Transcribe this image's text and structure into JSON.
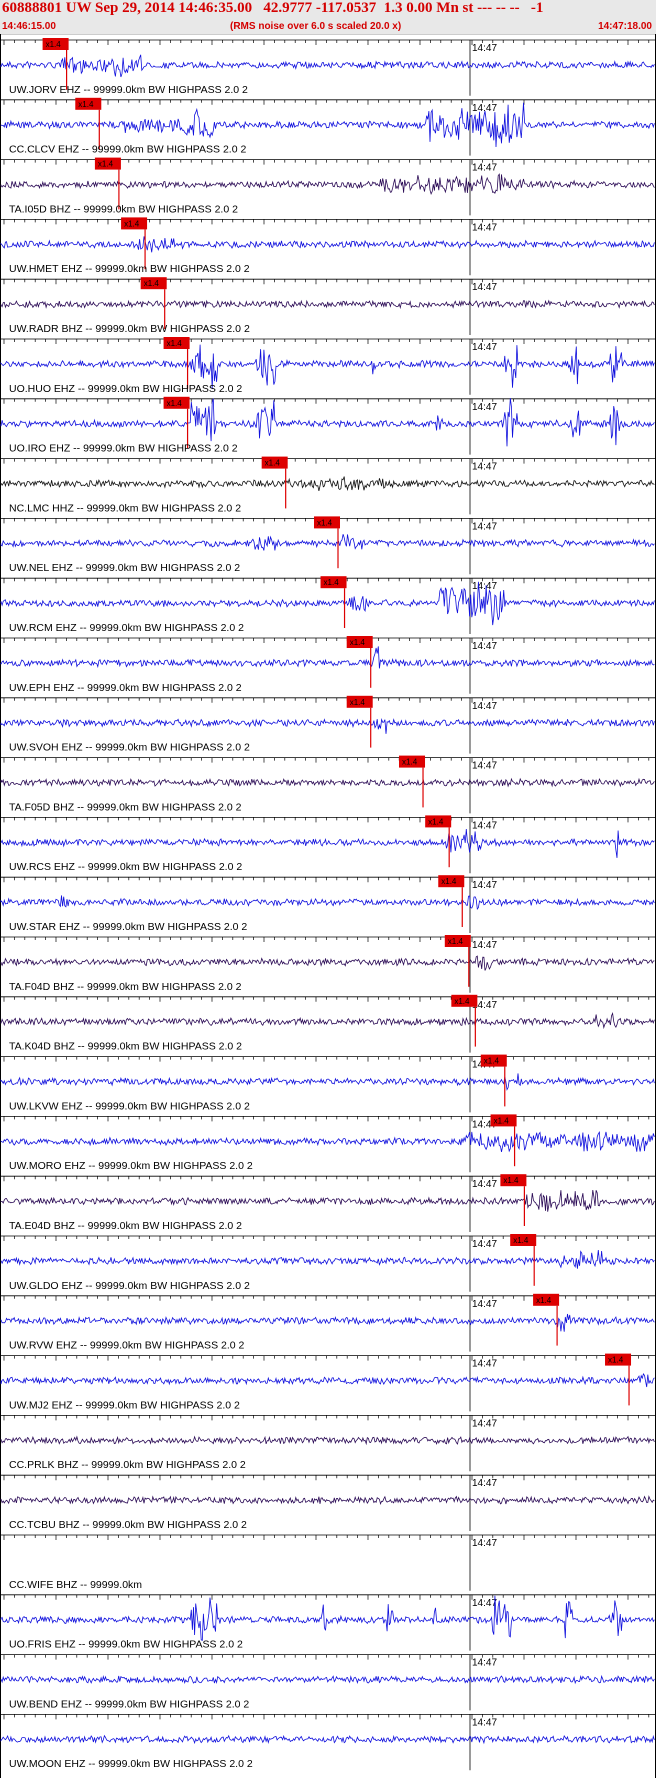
{
  "header": {
    "title": "60888801 UW Sep 29, 2014 14:46:35.00   42.9777 -117.0537  1.3 0.00 Mn st --- -- --   -1",
    "time_start": "14:46:15.00",
    "rms_note": "(RMS noise over 6.0 s scaled 20.0 x)",
    "time_end": "14:47:18.00"
  },
  "colors": {
    "blue": "#1010dd",
    "dark": "#2a0a55",
    "black": "#111111",
    "red": "#dd0000",
    "grid": "#000000"
  },
  "minute_label": "14:47",
  "pick_label": "x1.4",
  "traces": [
    {
      "label": "UW.JORV EHZ -- 99999.0km BW  HIGHPASS  2.0  2",
      "color": "blue",
      "pick": 0.085,
      "events": [
        [
          0.16,
          0.22,
          2.4
        ],
        [
          0.09,
          0.16,
          1.5
        ]
      ]
    },
    {
      "label": "CC.CLCV EHZ -- 99999.0km BW  HIGHPASS  2.0  2",
      "color": "blue",
      "pick": 0.135,
      "events": [
        [
          0.28,
          0.33,
          3.0
        ],
        [
          0.18,
          0.28,
          1.6
        ],
        [
          0.65,
          0.8,
          4.2
        ]
      ]
    },
    {
      "label": "TA.I05D BHZ -- 99999.0km BW  HIGHPASS  2.0  2",
      "color": "dark",
      "pick": 0.165,
      "events": [
        [
          0.58,
          0.8,
          2.0
        ]
      ]
    },
    {
      "label": "UW.HMET EHZ -- 99999.0km BW  HIGHPASS  2.0  2",
      "color": "blue",
      "pick": 0.205,
      "events": [
        [
          0.21,
          0.28,
          1.6
        ]
      ]
    },
    {
      "label": "UW.RADR BHZ -- 99999.0km BW  HIGHPASS  2.0  2",
      "color": "dark",
      "pick": 0.235,
      "events": []
    },
    {
      "label": "UO.HUO EHZ -- 99999.0km BW  HIGHPASS  2.0  2",
      "color": "blue",
      "pick": 0.27,
      "events": [
        [
          0.29,
          0.33,
          5.0
        ],
        [
          0.39,
          0.42,
          5.0
        ],
        [
          0.565,
          0.575,
          4.0
        ],
        [
          0.77,
          0.79,
          5.0
        ],
        [
          0.87,
          0.885,
          4.0
        ],
        [
          0.93,
          0.95,
          5.0
        ]
      ]
    },
    {
      "label": "UO.IRO EHZ -- 99999.0km BW  HIGHPASS  2.0  2",
      "color": "blue",
      "pick": 0.27,
      "events": [
        [
          0.29,
          0.33,
          5.0
        ],
        [
          0.39,
          0.42,
          5.0
        ],
        [
          0.665,
          0.675,
          3.5
        ],
        [
          0.77,
          0.79,
          5.0
        ],
        [
          0.87,
          0.885,
          4.0
        ],
        [
          0.93,
          0.95,
          5.0
        ]
      ]
    },
    {
      "label": "NC.LMC HHZ -- 99999.0km BW  HIGHPASS  2.0  2",
      "color": "black",
      "pick": 0.42,
      "events": [
        [
          0.44,
          0.6,
          1.5
        ]
      ]
    },
    {
      "label": "UW.NEL EHZ -- 99999.0km BW  HIGHPASS  2.0  2",
      "color": "blue",
      "pick": 0.5,
      "events": [
        [
          0.38,
          0.42,
          1.8
        ],
        [
          0.52,
          0.56,
          1.8
        ]
      ]
    },
    {
      "label": "UW.RCM EHZ -- 99999.0km BW  HIGHPASS  2.0  2",
      "color": "blue",
      "pick": 0.51,
      "events": [
        [
          0.53,
          0.56,
          2.0
        ],
        [
          0.67,
          0.77,
          4.5
        ]
      ]
    },
    {
      "label": "UW.EPH EHZ -- 99999.0km BW  HIGHPASS  2.0  2",
      "color": "blue",
      "pick": 0.55,
      "events": [
        [
          0.57,
          0.58,
          4.5
        ]
      ]
    },
    {
      "label": "UW.SVOH EHZ -- 99999.0km BW  HIGHPASS  2.0  2",
      "color": "blue",
      "pick": 0.55,
      "events": [
        [
          0.57,
          0.59,
          2.2
        ]
      ]
    },
    {
      "label": "TA.F05D BHZ -- 99999.0km BW  HIGHPASS  2.0  2",
      "color": "dark",
      "pick": 0.63,
      "events": []
    },
    {
      "label": "UW.RCS EHZ -- 99999.0km BW  HIGHPASS  2.0  2",
      "color": "blue",
      "pick": 0.67,
      "events": [
        [
          0.68,
          0.74,
          2.6
        ],
        [
          0.94,
          0.945,
          3.5
        ]
      ]
    },
    {
      "label": "UW.STAR EHZ -- 99999.0km BW  HIGHPASS  2.0  2",
      "color": "blue",
      "pick": 0.69,
      "events": [
        [
          0.09,
          0.11,
          2.0
        ],
        [
          0.71,
          0.73,
          2.2
        ]
      ]
    },
    {
      "label": "TA.F04D BHZ -- 99999.0km BW  HIGHPASS  2.0  2",
      "color": "dark",
      "pick": 0.7,
      "events": [
        [
          0.72,
          0.75,
          2.0
        ]
      ]
    },
    {
      "label": "TA.K04D BHZ -- 99999.0km BW  HIGHPASS  2.0  2",
      "color": "dark",
      "pick": 0.71,
      "events": [
        [
          0.9,
          0.95,
          1.8
        ]
      ]
    },
    {
      "label": "UW.LKVW EHZ -- 99999.0km BW  HIGHPASS  2.0  2",
      "color": "blue",
      "pick": 0.755,
      "events": [
        [
          0.77,
          0.8,
          1.6
        ]
      ]
    },
    {
      "label": "UW.MORO EHZ -- 99999.0km BW  HIGHPASS  2.0  2",
      "color": "blue",
      "pick": 0.77,
      "events": [
        [
          0.71,
          1.0,
          2.2
        ]
      ]
    },
    {
      "label": "TA.E04D BHZ -- 99999.0km BW  HIGHPASS  2.0  2",
      "color": "dark",
      "pick": 0.785,
      "events": [
        [
          0.8,
          0.92,
          2.4
        ]
      ]
    },
    {
      "label": "UW.GLDO EHZ -- 99999.0km BW  HIGHPASS  2.0  2",
      "color": "blue",
      "pick": 0.8,
      "events": [
        [
          0.85,
          0.92,
          2.0
        ]
      ]
    },
    {
      "label": "UW.RVW EHZ -- 99999.0km BW  HIGHPASS  2.0  2",
      "color": "blue",
      "pick": 0.835,
      "events": [
        [
          0.85,
          0.87,
          2.8
        ]
      ]
    },
    {
      "label": "UW.MJ2 EHZ -- 99999.0km BW  HIGHPASS  2.0  2",
      "color": "blue",
      "pick": 0.945,
      "events": [
        [
          0.975,
          0.99,
          2.0
        ]
      ]
    },
    {
      "label": "CC.PRLK BHZ -- 99999.0km BW  HIGHPASS  2.0  2",
      "color": "dark",
      "pick": null,
      "events": []
    },
    {
      "label": "CC.TCBU BHZ -- 99999.0km BW  HIGHPASS  2.0  2",
      "color": "dark",
      "pick": null,
      "events": []
    },
    {
      "label": "CC.WIFE BHZ -- 99999.0km",
      "color": "none",
      "pick": null,
      "events": []
    },
    {
      "label": "UO.FRIS EHZ -- 99999.0km BW  HIGHPASS  2.0  2",
      "color": "blue",
      "pick": null,
      "events": [
        [
          0.29,
          0.33,
          5.0
        ],
        [
          0.49,
          0.5,
          4.0
        ],
        [
          0.59,
          0.6,
          4.0
        ],
        [
          0.66,
          0.665,
          3.5
        ],
        [
          0.75,
          0.78,
          5.0
        ],
        [
          0.86,
          0.875,
          4.5
        ],
        [
          0.93,
          0.95,
          5.0
        ]
      ]
    },
    {
      "label": "UW.BEND EHZ -- 99999.0km BW  HIGHPASS  2.0  2",
      "color": "blue",
      "pick": null,
      "events": []
    },
    {
      "label": "UW.MOON EHZ -- 99999.0km BW  HIGHPASS  2.0  2",
      "color": "blue",
      "pick": null,
      "events": []
    }
  ]
}
